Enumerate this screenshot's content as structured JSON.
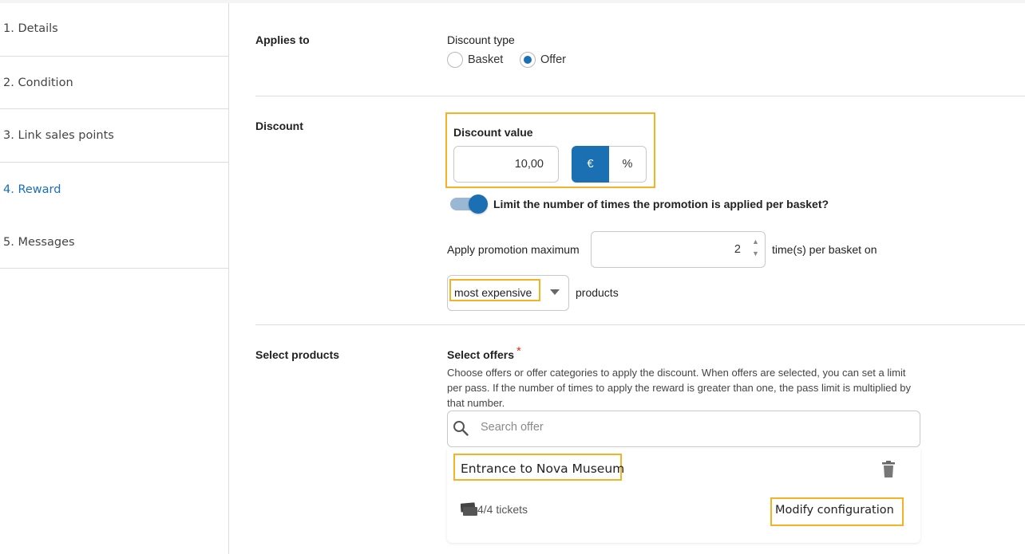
{
  "sidebar": {
    "steps": [
      {
        "label": "1. Details"
      },
      {
        "label": "2. Condition"
      },
      {
        "label": "3. Link sales points"
      },
      {
        "label": "4. Reward",
        "active": true
      },
      {
        "label": "5. Messages"
      }
    ]
  },
  "applies_to": {
    "section_label": "Applies to",
    "discount_type_label": "Discount type",
    "options": [
      "Basket",
      "Offer"
    ],
    "selected": "Offer"
  },
  "discount": {
    "section_label": "Discount",
    "value_label": "Discount value",
    "value": "10,00",
    "units": [
      "€",
      "%"
    ],
    "selected_unit": "€",
    "limit_toggle_label": "Limit the number of times the promotion is applied per basket?",
    "limit_enabled": true,
    "apply_max_label": "Apply promotion maximum",
    "apply_max_value": "2",
    "apply_max_suffix": "time(s) per basket on",
    "product_sort_value": "most expensive",
    "product_sort_suffix": "products"
  },
  "select_products": {
    "section_label": "Select products",
    "offers_label": "Select offers",
    "required_mark": "*",
    "help_text": "Choose offers or offer categories to apply the discount. When offers are selected, you can set a limit per pass. If the number of times to apply the reward is greater than one, the pass limit is multiplied by that number.",
    "search_placeholder": "Search offer",
    "offers": [
      {
        "title": "Entrance to Nova Museum",
        "tickets": "4/4 tickets",
        "modify_label": "Modify configuration"
      }
    ]
  },
  "colors": {
    "accent": "#1b6fb3",
    "highlight": "#f5b323",
    "required": "#d93025"
  }
}
